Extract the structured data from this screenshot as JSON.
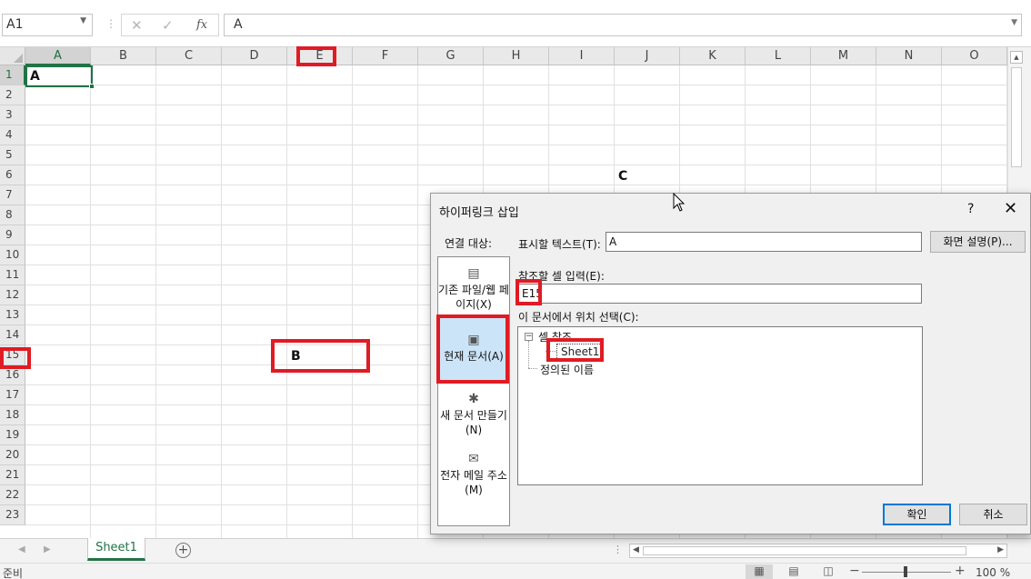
{
  "formula_bar": {
    "name_box": "A1",
    "cancel_icon": "✕",
    "enter_icon": "✓",
    "fx_label": "fx",
    "value": "A"
  },
  "grid": {
    "columns": [
      "A",
      "B",
      "C",
      "D",
      "E",
      "F",
      "G",
      "H",
      "I",
      "J",
      "K",
      "L",
      "M",
      "N",
      "O"
    ],
    "rows": [
      "1",
      "2",
      "3",
      "4",
      "5",
      "6",
      "7",
      "8",
      "9",
      "10",
      "11",
      "12",
      "13",
      "14",
      "15",
      "16",
      "17",
      "18",
      "19",
      "20",
      "21",
      "22",
      "23"
    ],
    "selected_column": "A",
    "selected_row": "1",
    "cells": {
      "A1": "A",
      "J6": "C",
      "E15": "B"
    }
  },
  "sheet_tabs": {
    "active": "Sheet1"
  },
  "status_bar": {
    "ready": "준비",
    "zoom": "100 %"
  },
  "dialog": {
    "title": "하이퍼링크 삽입",
    "help": "?",
    "close": "✕",
    "link_to_label": "연결 대상:",
    "link_options": [
      {
        "label": "기존 파일/웹 페이지(X)",
        "icon": "globe-page-icon"
      },
      {
        "label": "현재 문서(A)",
        "icon": "document-icon",
        "selected": true
      },
      {
        "label": "새 문서 만들기(N)",
        "icon": "new-document-icon"
      },
      {
        "label": "전자 메일 주소(M)",
        "icon": "email-icon"
      }
    ],
    "display_text_label": "표시할 텍스트(T):",
    "display_text_value": "A",
    "screen_tip_button": "화면 설명(P)...",
    "cell_ref_label": "참조할 셀 입력(E):",
    "cell_ref_value": "E15",
    "place_label": "이 문서에서 위치 선택(C):",
    "tree": {
      "root": "셀 참조",
      "child": "Sheet1",
      "names": "정의된 이름"
    },
    "ok_button": "확인",
    "cancel_button": "취소"
  },
  "colors": {
    "excel_green": "#217346",
    "highlight_red": "#e01b24",
    "selection_blue": "#cce4f7"
  }
}
